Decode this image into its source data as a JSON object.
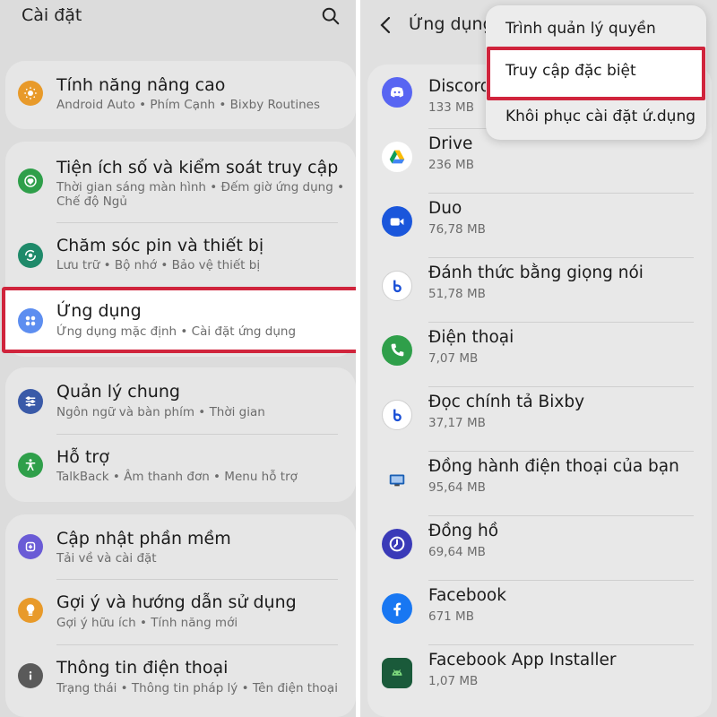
{
  "left": {
    "header": {
      "title": "Cài đặt",
      "search_icon": "search-icon"
    },
    "items": [
      {
        "title": "Tính năng nâng cao",
        "subtitle": "Android Auto  •  Phím Cạnh  •  Bixby Routines",
        "icon": "gear-sparkle-icon",
        "color": "#e89a2a"
      },
      {
        "title": "Tiện ích số và kiểm soát truy cập",
        "subtitle": "Thời gian sáng màn hình  •  Đếm giờ ứng dụng  •",
        "subtitle2": "Chế độ Ngủ",
        "icon": "heart-circle-icon",
        "color": "#2f9f4a"
      },
      {
        "title": "Chăm sóc pin và thiết bị",
        "subtitle": "Lưu trữ  •  Bộ nhớ  •  Bảo vệ thiết bị",
        "icon": "refresh-circle-icon",
        "color": "#1f8a6a"
      },
      {
        "title": "Ứng dụng",
        "subtitle": "Ứng dụng mặc định  •  Cài đặt ứng dụng",
        "icon": "apps-grid-icon",
        "color": "#5d8ef0"
      },
      {
        "title": "Quản lý chung",
        "subtitle": "Ngôn ngữ và bàn phím  •  Thời gian",
        "icon": "sliders-icon",
        "color": "#3a5aa8"
      },
      {
        "title": "Hỗ trợ",
        "subtitle": "TalkBack  •  Âm thanh đơn  •  Menu hỗ trợ",
        "icon": "accessibility-icon",
        "color": "#2f9f4a"
      },
      {
        "title": "Cập nhật phần mềm",
        "subtitle": "Tải về và cài đặt",
        "icon": "update-icon",
        "color": "#6a5bd6"
      },
      {
        "title": "Gợi ý và hướng dẫn sử dụng",
        "subtitle": "Gợi ý hữu ích  •  Tính năng mới",
        "icon": "lightbulb-icon",
        "color": "#e89a2a"
      },
      {
        "title": "Thông tin điện thoại",
        "subtitle": "Trạng thái  •  Thông tin pháp lý  •  Tên điện thoại",
        "icon": "info-icon",
        "color": "#5a5a5a"
      }
    ]
  },
  "right": {
    "header": {
      "title": "Ứng dụng",
      "back_icon": "back-chevron-icon"
    },
    "menu": [
      "Trình quản lý quyền",
      "Truy cập đặc biệt",
      "Khôi phục cài đặt ứ.dụng"
    ],
    "apps": [
      {
        "name": "Discord",
        "size": "133 MB",
        "icon": "discord-icon",
        "color": "#5865f2"
      },
      {
        "name": "Drive",
        "size": "236 MB",
        "icon": "google-drive-icon",
        "color": "#ffffff"
      },
      {
        "name": "Duo",
        "size": "76,78 MB",
        "icon": "duo-video-icon",
        "color": "#1a56db"
      },
      {
        "name": "Đánh thức bằng giọng nói",
        "size": "51,78 MB",
        "icon": "bixby-icon",
        "color": "#ffffff"
      },
      {
        "name": "Điện thoại",
        "size": "7,07 MB",
        "icon": "phone-icon",
        "color": "#2f9f4a"
      },
      {
        "name": "Đọc chính tả Bixby",
        "size": "37,17 MB",
        "icon": "bixby-icon",
        "color": "#ffffff"
      },
      {
        "name": "Đồng hành điện thoại của bạn",
        "size": "95,64 MB",
        "icon": "phone-companion-icon",
        "color": "#e8e8e8"
      },
      {
        "name": "Đồng hồ",
        "size": "69,64 MB",
        "icon": "clock-icon",
        "color": "#3a3ab8"
      },
      {
        "name": "Facebook",
        "size": "671 MB",
        "icon": "facebook-icon",
        "color": "#1877f2"
      },
      {
        "name": "Facebook App Installer",
        "size": "1,07 MB",
        "icon": "android-icon",
        "color": "#1a5a3a"
      }
    ]
  }
}
